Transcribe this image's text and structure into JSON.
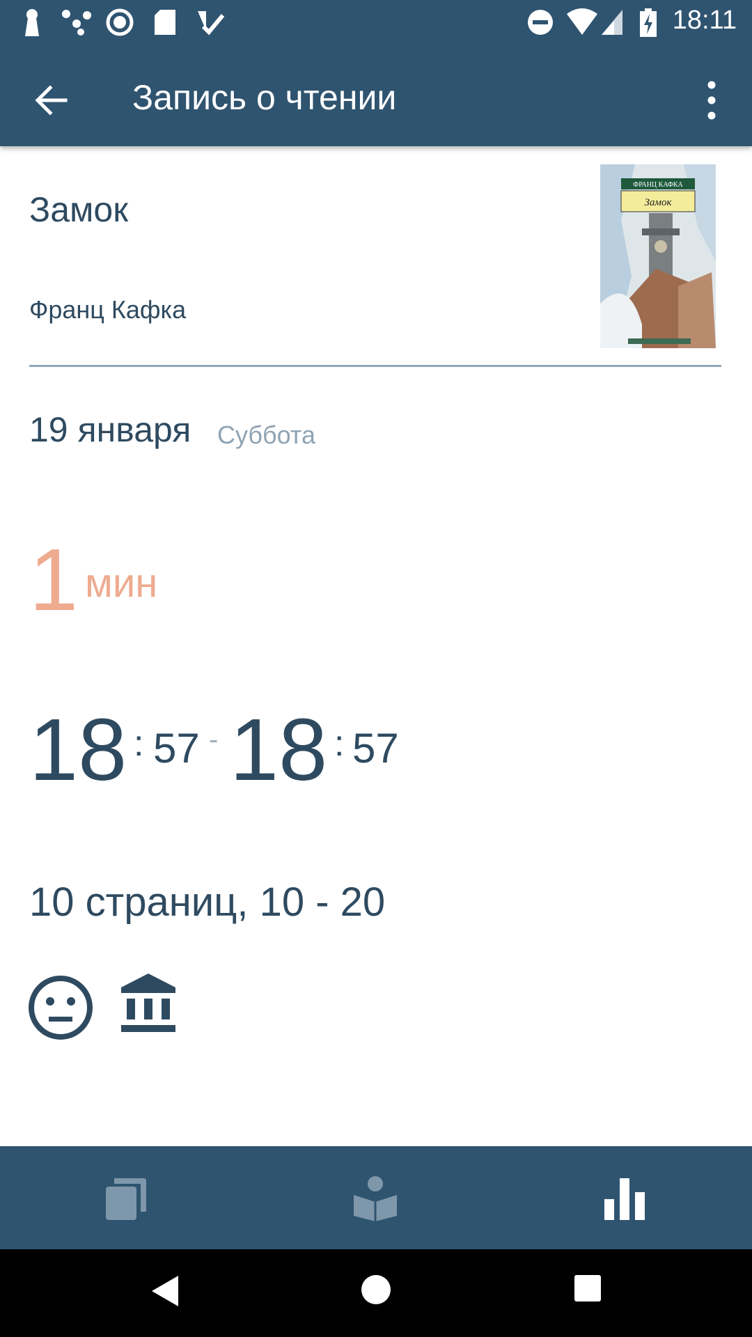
{
  "status_bar": {
    "time": "18:11",
    "icons": [
      "keyhole-icon",
      "share-icon",
      "record-icon",
      "sd-card-icon",
      "check-icon",
      "dnd-icon",
      "wifi-icon",
      "signal-icon",
      "battery-charging-icon"
    ]
  },
  "app_bar": {
    "title": "Запись о чтении",
    "back_icon": "arrow-back-icon",
    "menu_icon": "more-vert-icon"
  },
  "book": {
    "title": "Замок",
    "author": "Франц Кафка",
    "cover_text_author": "ФРАНЦ КАФКА",
    "cover_text_title": "Замок"
  },
  "session": {
    "date": "19 января",
    "weekday": "Суббота",
    "duration_value": "1",
    "duration_unit": "мин",
    "start_hour": "18",
    "start_minute": "57",
    "end_hour": "18",
    "end_minute": "57",
    "time_sep": ":",
    "range_sep": "-",
    "pages": "10 страниц, 10 - 20",
    "mood_icon": "neutral-face-icon",
    "place_icon": "library-icon"
  },
  "bottom_nav": {
    "items": [
      {
        "icon": "books-icon"
      },
      {
        "icon": "reading-icon"
      },
      {
        "icon": "stats-icon"
      }
    ]
  },
  "colors": {
    "primary": "#2f5470",
    "text": "#2e4a60",
    "accent": "#eeab90",
    "muted": "#8fa3b3"
  }
}
